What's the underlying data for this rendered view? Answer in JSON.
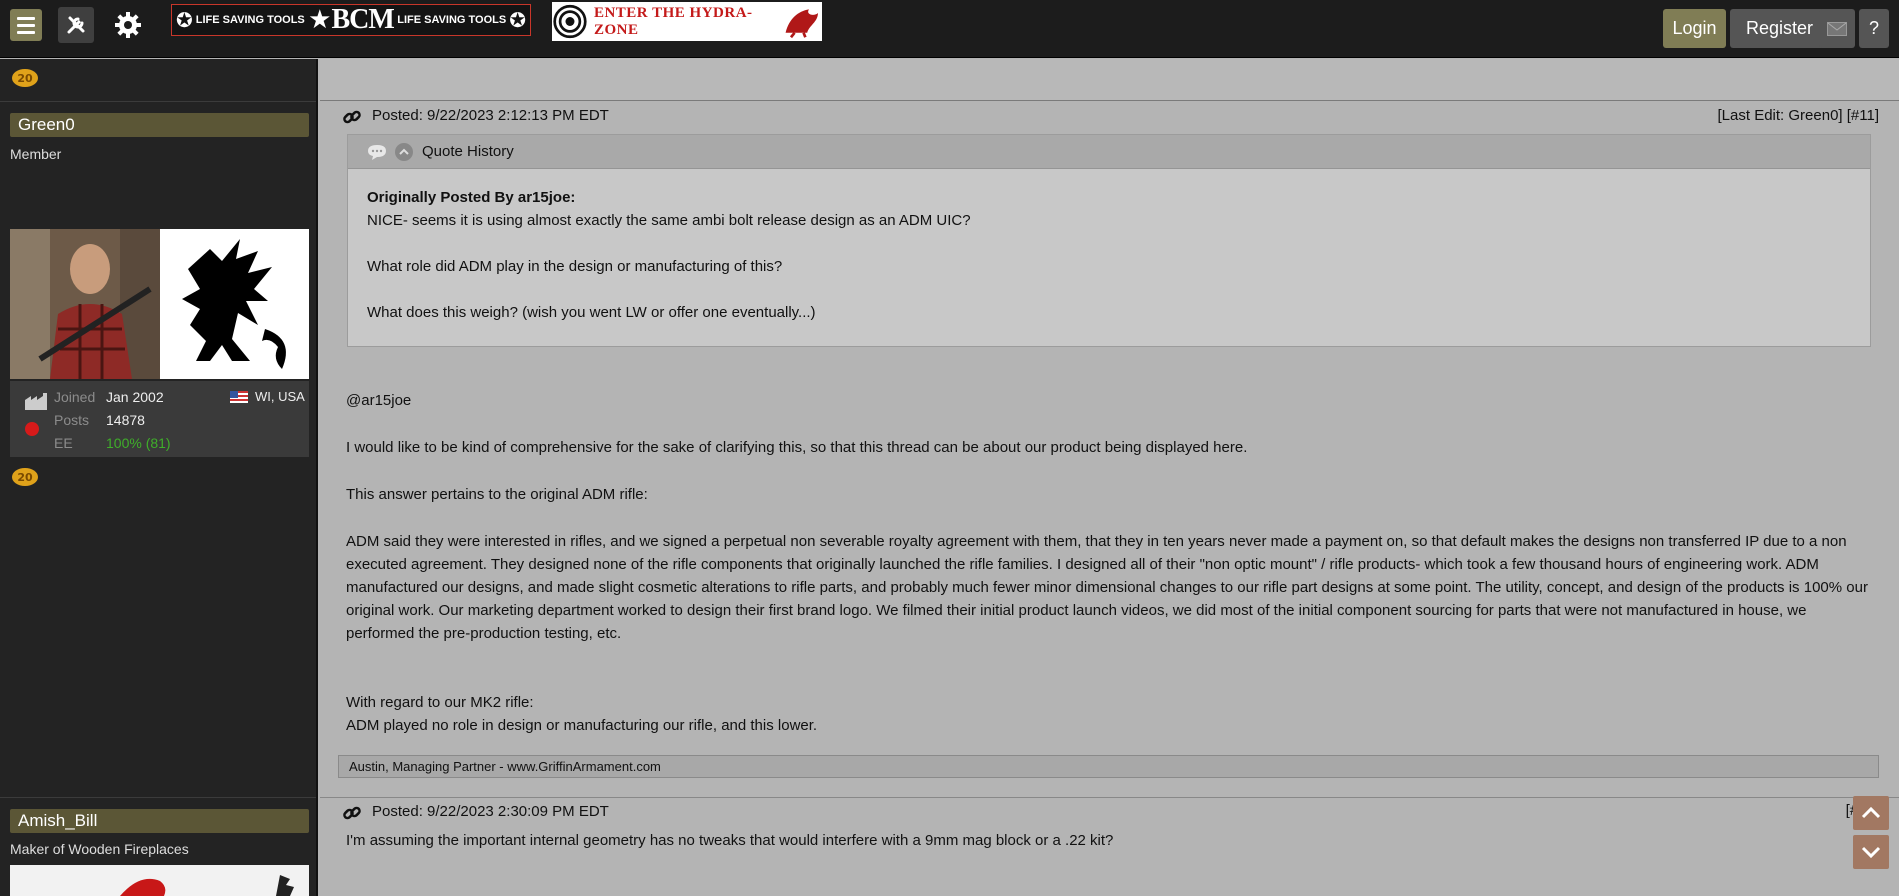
{
  "topbar": {
    "menu_icon": "hamburger-icon",
    "tools_icon": "wrench-screwdriver-icon",
    "gear_icon": "gear-icon",
    "banner_bcm": {
      "left_text": "LIFE SAVING TOOLS",
      "logo": "BCM",
      "right_text": "LIFE SAVING TOOLS"
    },
    "banner_hydra": {
      "text": "ENTER THE HYDRA-ZONE"
    },
    "login_label": "Login",
    "register_label": "Register",
    "help_label": "?"
  },
  "sidebar": {
    "badge_text": "20",
    "user1": {
      "name": "Green0",
      "title": "Member",
      "joined_label": "Joined",
      "joined_value": "Jan 2002",
      "location": "WI, USA",
      "posts_label": "Posts",
      "posts_value": "14878",
      "ee_label": "EE",
      "ee_value": "100% (81)"
    },
    "user2": {
      "name": "Amish_Bill",
      "title": "Maker of Wooden Fireplaces"
    }
  },
  "post11": {
    "posted": "Posted: 9/22/2023 2:12:13 PM EDT",
    "last_edit": "[Last Edit: Green0] [#11]",
    "quote_history_label": "Quote History",
    "quote_author": "Originally Posted By ar15joe:",
    "quote_line1": "NICE- seems it is using almost exactly the same ambi bolt release design as an ADM UIC?",
    "quote_line2": "What role did ADM play in the design or manufacturing of this?",
    "quote_line3": "What does this weigh? (wish you went LW or offer one eventually...)",
    "p1": "@ar15joe",
    "p2": "I would like to be kind of comprehensive for the sake of clarifying this, so that this thread can be about our product being displayed here.",
    "p3": "This answer pertains to the original ADM rifle:",
    "p4": "ADM said they were interested in rifles, and we signed a perpetual non severable royalty agreement with them, that they in ten years never made a payment on, so that default makes the designs non transferred IP due to a non executed agreement.  They designed none of the rifle components that originally launched the rifle families.  I designed all of their \"non optic mount\" / rifle products- which took a few thousand hours of engineering work.  ADM manufactured our designs, and made slight cosmetic alterations to rifle parts, and probably much fewer minor dimensional changes to our rifle part designs at some point.  The utility, concept, and design of the products is 100% our original work.  Our marketing department worked to design their first brand logo.  We filmed their initial product launch videos, we did most of the initial component sourcing for parts that were not manufactured in house, we performed the pre-production testing, etc.",
    "p5": "With regard to our MK2 rifle:",
    "p6": "ADM played no role in design or manufacturing our rifle, and this lower.",
    "signature": "Austin, Managing Partner - www.GriffinArmament.com"
  },
  "post12": {
    "posted": "Posted: 9/22/2023 2:30:09 PM EDT",
    "number": "[#12]",
    "text": "I'm assuming the important internal geometry has no tweaks that would interfere with a 9mm mag block or a .22 kit?"
  },
  "colors": {
    "accent": "#807d55",
    "sidebar_bg": "#232323",
    "main_bg": "#b4b4b4",
    "ee_green": "#3fae2a"
  }
}
